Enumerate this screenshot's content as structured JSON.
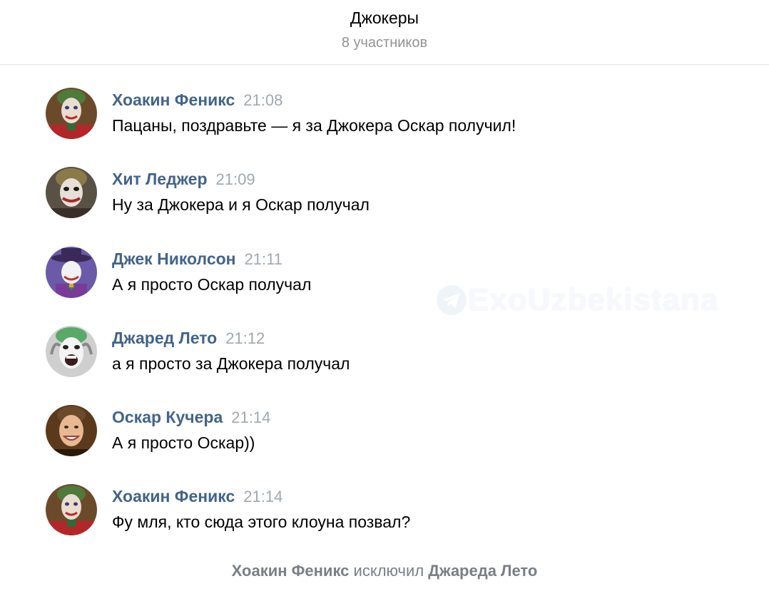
{
  "header": {
    "title": "Джокеры",
    "subtitle": "8 участников"
  },
  "messages": [
    {
      "author": "Хоакин Феникс",
      "time": "21:08",
      "text": "Пацаны, поздравьте — я за Джокера Оскар получил!",
      "avatar_icon": "joaquin-joker-avatar"
    },
    {
      "author": "Хит Леджер",
      "time": "21:09",
      "text": "Ну за Джокера и я Оскар получал",
      "avatar_icon": "heath-joker-avatar"
    },
    {
      "author": "Джек Николсон",
      "time": "21:11",
      "text": "А я просто Оскар получал",
      "avatar_icon": "nicholson-joker-avatar"
    },
    {
      "author": "Джаред Лето",
      "time": "21:12",
      "text": "а я просто за Джокера получал",
      "avatar_icon": "leto-joker-avatar"
    },
    {
      "author": "Оскар Кучера",
      "time": "21:14",
      "text": "А я просто Оскар))",
      "avatar_icon": "kuchera-avatar"
    },
    {
      "author": "Хоакин Феникс",
      "time": "21:14",
      "text": "Фу мля, кто сюда этого клоуна позвал?",
      "avatar_icon": "joaquin-joker-avatar"
    }
  ],
  "system_event": {
    "actor": "Хоакин Феникс",
    "action": "исключил",
    "target": "Джареда Лето"
  },
  "watermark": {
    "text": "ExoUzbekistana",
    "icon": "telegram-icon"
  },
  "colors": {
    "author": "#42648b",
    "time": "#a1a8b0",
    "subtitle": "#939393",
    "system": "#7a7f85"
  }
}
